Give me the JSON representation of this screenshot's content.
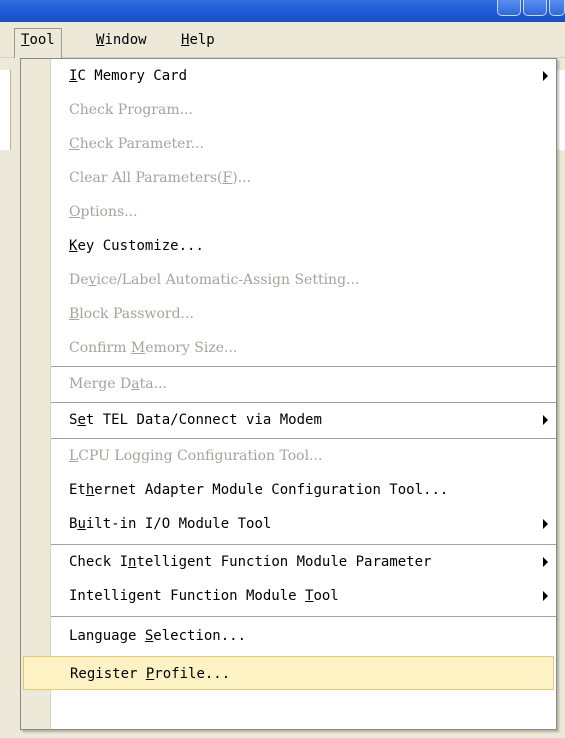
{
  "menubar": {
    "items": [
      {
        "label": "Tool",
        "accel": "T",
        "rest": "ool",
        "active": true
      },
      {
        "label": "Window",
        "accel": "W",
        "rest": "indow",
        "active": false
      },
      {
        "label": "Help",
        "accel": "H",
        "rest": "elp",
        "active": false
      }
    ]
  },
  "menu": {
    "items": [
      {
        "pre": "",
        "accel": "I",
        "post": "C Memory Card",
        "enabled": true,
        "submenu": true
      },
      {
        "pre": "Check Program...",
        "accel": "",
        "post": "",
        "enabled": false,
        "submenu": false
      },
      {
        "pre": "",
        "accel": "C",
        "post": "heck Parameter...",
        "enabled": false,
        "submenu": false
      },
      {
        "pre": "Clear All Parameters(",
        "accel": "F",
        "post": ")...",
        "enabled": false,
        "submenu": false
      },
      {
        "pre": "",
        "accel": "O",
        "post": "ptions...",
        "enabled": false,
        "submenu": false
      },
      {
        "pre": "",
        "accel": "K",
        "post": "ey Customize...",
        "enabled": true,
        "submenu": false
      },
      {
        "pre": "De",
        "accel": "v",
        "post": "ice/Label Automatic-Assign Setting...",
        "enabled": false,
        "submenu": false
      },
      {
        "pre": "",
        "accel": "B",
        "post": "lock Password...",
        "enabled": false,
        "submenu": false
      },
      {
        "pre": "Confirm ",
        "accel": "M",
        "post": "emory Size...",
        "enabled": false,
        "submenu": false
      },
      {
        "pre": "Merge D",
        "accel": "a",
        "post": "ta...",
        "enabled": false,
        "submenu": false
      },
      {
        "pre": "S",
        "accel": "e",
        "post": "t TEL Data/Connect via Modem",
        "enabled": true,
        "submenu": true
      },
      {
        "pre": "",
        "accel": "L",
        "post": "CPU Logging Configuration Tool...",
        "enabled": false,
        "submenu": false
      },
      {
        "pre": "Et",
        "accel": "h",
        "post": "ernet Adapter Module Configuration Tool...",
        "enabled": true,
        "submenu": false
      },
      {
        "pre": "B",
        "accel": "u",
        "post": "ilt-in I/O Module Tool",
        "enabled": true,
        "submenu": true
      },
      {
        "pre": "Check I",
        "accel": "n",
        "post": "telligent Function Module Parameter",
        "enabled": true,
        "submenu": true
      },
      {
        "pre": "Intelligent Function Module ",
        "accel": "T",
        "post": "ool",
        "enabled": true,
        "submenu": true
      },
      {
        "pre": "Language ",
        "accel": "S",
        "post": "election...",
        "enabled": true,
        "submenu": false
      },
      {
        "pre": "Register ",
        "accel": "P",
        "post": "rofile...",
        "enabled": true,
        "submenu": false,
        "highlighted": true
      }
    ]
  },
  "colors": {
    "titlebar": "#1d59d6",
    "menu_gutter": "#ece9d8",
    "highlight_bg": "#fdf2c4",
    "disabled_text": "#a7a39a"
  }
}
